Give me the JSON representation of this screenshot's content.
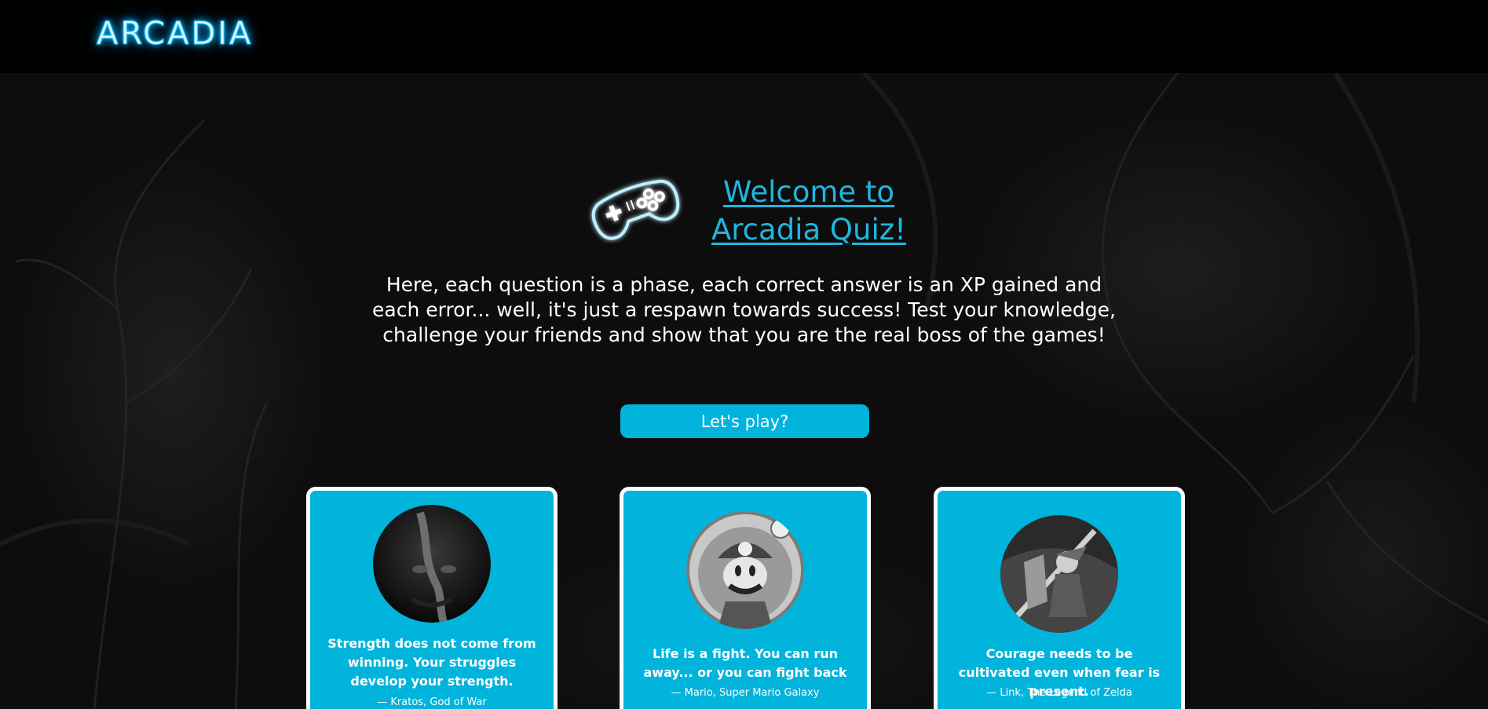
{
  "header": {
    "brand": "ARCADIA"
  },
  "hero": {
    "title_line1": "Welcome to",
    "title_line2": "Arcadia Quiz!",
    "intro": "Here, each question is a phase, each correct answer is an XP gained and each error... well, it's just a respawn towards success! Test your knowledge, challenge your friends and show that you are the real boss of the games!",
    "cta_label": "Let's play?",
    "icon": "game-controller-icon"
  },
  "cards": [
    {
      "quote": "Strength does not come from winning. Your struggles develop your strength.",
      "author": "— Kratos, God of War",
      "portrait": "kratos-portrait"
    },
    {
      "quote": "Life is a fight. You can run away... or you can fight back",
      "author": "— Mario, Super Mario Galaxy",
      "portrait": "mario-portrait"
    },
    {
      "quote": "Courage needs to be cultivated even when fear is present.",
      "author": "— Link, The Legend of Zelda",
      "portrait": "link-portrait"
    }
  ],
  "colors": {
    "accent": "#00b4dc",
    "title": "#1fb6e0",
    "background": "#000000"
  }
}
